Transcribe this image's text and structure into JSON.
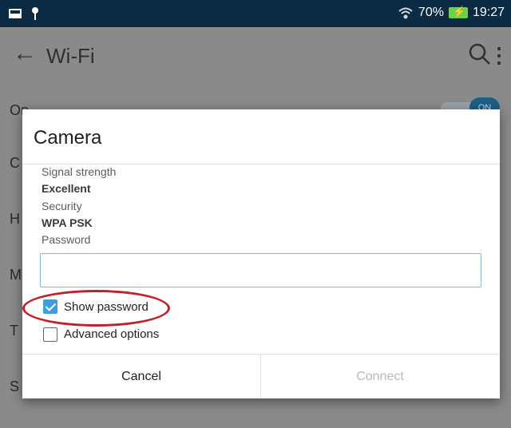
{
  "status_bar": {
    "battery_text": "70%",
    "time": "19:27",
    "icons": [
      "gallery-icon",
      "pin-icon",
      "wifi-icon",
      "battery-charging-icon"
    ]
  },
  "app_bar": {
    "title": "Wi-Fi",
    "icons": [
      "back-arrow-icon",
      "search-icon",
      "more-vert-icon"
    ]
  },
  "background_list": {
    "rows": [
      "On",
      "C",
      "H",
      "M",
      "T",
      "S"
    ],
    "toggle_label": "ON"
  },
  "dialog": {
    "title": "Camera",
    "signal_label": "Signal strength",
    "signal_value": "Excellent",
    "security_label": "Security",
    "security_value": "WPA PSK",
    "password_label": "Password",
    "password_value": "",
    "show_password": {
      "label": "Show password",
      "checked": true
    },
    "advanced_options": {
      "label": "Advanced options",
      "checked": false
    },
    "cancel_label": "Cancel",
    "connect_label": "Connect"
  },
  "colors": {
    "status_bar": "#0b2b44",
    "scrim": "#8a8a8a",
    "accent": "#3b9ee0",
    "highlight": "#c0202a",
    "disabled_text": "#b9b9b9"
  }
}
